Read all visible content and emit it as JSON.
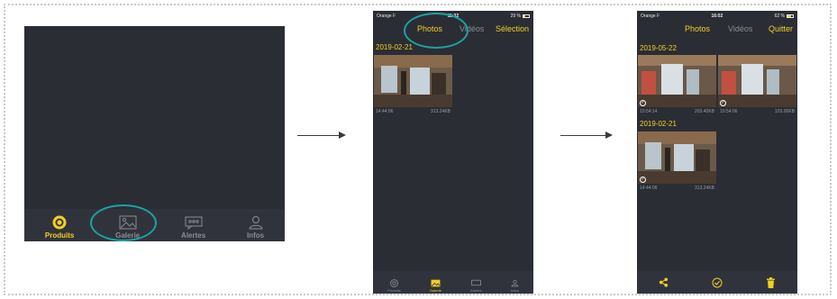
{
  "screen1": {
    "tabs": [
      {
        "label": "Produits",
        "icon": "target-icon",
        "active": true
      },
      {
        "label": "Galerie",
        "icon": "image-icon",
        "active": false
      },
      {
        "label": "Alertes",
        "icon": "chat-bubble-icon",
        "active": false
      },
      {
        "label": "Infos",
        "icon": "person-icon",
        "active": false
      }
    ]
  },
  "screen2": {
    "status": {
      "carrier": "Orange F",
      "time": "11:32",
      "battery": "29 %"
    },
    "nav": {
      "photos": "Photos",
      "videos": "Vidéos",
      "selection": "Sélection"
    },
    "date": "2019-02-21",
    "photo": {
      "time": "14:44:06",
      "size": "313.24KB"
    },
    "tabs": [
      {
        "label": "Produits"
      },
      {
        "label": "Galerie"
      },
      {
        "label": "Alertes"
      },
      {
        "label": "Infos"
      }
    ]
  },
  "screen3": {
    "status": {
      "carrier": "Orange F",
      "time": "16:02",
      "battery": "62 %"
    },
    "nav": {
      "photos": "Photos",
      "videos": "Vidéos",
      "quit": "Quitter"
    },
    "group1": {
      "date": "2019-05-22",
      "photos": [
        {
          "time": "10:54:14",
          "size": "203.40KB"
        },
        {
          "time": "10:54:06",
          "size": "103.00KB"
        }
      ]
    },
    "group2": {
      "date": "2019-02-21",
      "photos": [
        {
          "time": "14:44:06",
          "size": "313.24KB"
        }
      ]
    },
    "actions": [
      "share-icon",
      "check-circle-icon",
      "trash-icon"
    ]
  },
  "colors": {
    "accent": "#f2cf1f",
    "background": "#2b2d35",
    "highlight_ring": "#1aa3a3"
  }
}
